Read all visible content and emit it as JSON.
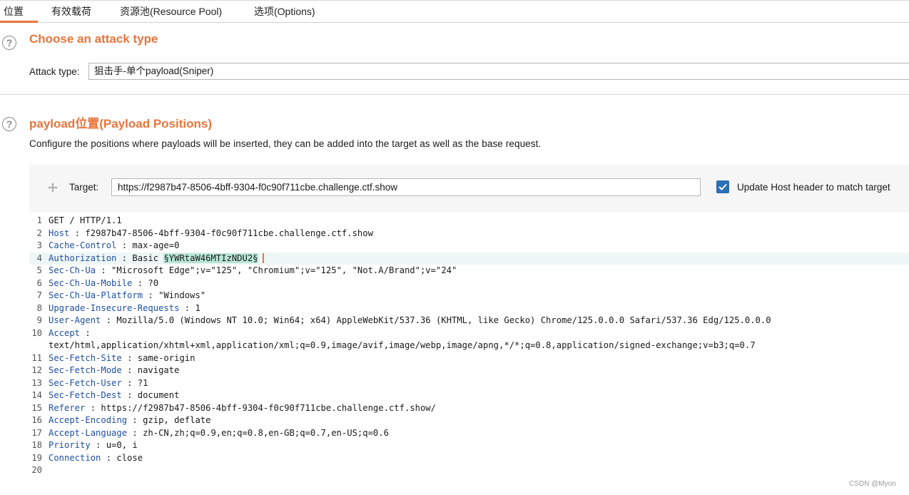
{
  "tabs": [
    "位置",
    "有效载荷",
    "资源池(Resource Pool)",
    "选项(Options)"
  ],
  "attack_section": {
    "title": "Choose an attack type",
    "attack_type_label": "Attack type:",
    "attack_type_value": "狙击手-单个payload(Sniper)"
  },
  "positions_section": {
    "title": "payload位置(Payload Positions)",
    "description": "Configure the positions where payloads will be inserted, they can be added into the target as well as the base request.",
    "target_label": "Target:",
    "target_value": "https://f2987b47-8506-4bff-9304-f0c90f711cbe.challenge.ctf.show",
    "update_host_label": "Update Host header to match target",
    "update_host_checked": true
  },
  "request": {
    "lines": [
      {
        "num": "1",
        "name": "",
        "value": "GET / HTTP/1.1"
      },
      {
        "num": "2",
        "name": "Host",
        "value": " : f2987b47-8506-4bff-9304-f0c90f711cbe.challenge.ctf.show"
      },
      {
        "num": "3",
        "name": "Cache-Control",
        "value": " : max-age=0"
      },
      {
        "num": "4",
        "name": "Authorization",
        "value": " : Basic ",
        "payload": "§YWRtaW46MTIzNDU2§"
      },
      {
        "num": "5",
        "name": "Sec-Ch-Ua",
        "value": " : \"Microsoft Edge\";v=\"125\", \"Chromium\";v=\"125\", \"Not.A/Brand\";v=\"24\""
      },
      {
        "num": "6",
        "name": "Sec-Ch-Ua-Mobile",
        "value": " : ?0"
      },
      {
        "num": "7",
        "name": "Sec-Ch-Ua-Platform",
        "value": " : \"Windows\""
      },
      {
        "num": "8",
        "name": "Upgrade-Insecure-Requests",
        "value": " : 1"
      },
      {
        "num": "9",
        "name": "User-Agent",
        "value": " : Mozilla/5.0 (Windows NT 10.0; Win64; x64) AppleWebKit/537.36 (KHTML, like Gecko) Chrome/125.0.0.0 Safari/537.36 Edg/125.0.0.0"
      },
      {
        "num": "10",
        "name": "Accept",
        "value": " :"
      },
      {
        "num": "",
        "name": "",
        "value": "text/html,application/xhtml+xml,application/xml;q=0.9,image/avif,image/webp,image/apng,*/*;q=0.8,application/signed-exchange;v=b3;q=0.7"
      },
      {
        "num": "11",
        "name": "Sec-Fetch-Site",
        "value": " : same-origin"
      },
      {
        "num": "12",
        "name": "Sec-Fetch-Mode",
        "value": " : navigate"
      },
      {
        "num": "13",
        "name": "Sec-Fetch-User",
        "value": " : ?1"
      },
      {
        "num": "14",
        "name": "Sec-Fetch-Dest",
        "value": " : document"
      },
      {
        "num": "15",
        "name": "Referer",
        "value": " : https://f2987b47-8506-4bff-9304-f0c90f711cbe.challenge.ctf.show/"
      },
      {
        "num": "16",
        "name": "Accept-Encoding",
        "value": " : gzip, deflate"
      },
      {
        "num": "17",
        "name": "Accept-Language",
        "value": " : zh-CN,zh;q=0.9,en;q=0.8,en-GB;q=0.7,en-US;q=0.6"
      },
      {
        "num": "18",
        "name": "Priority",
        "value": " : u=0, i"
      },
      {
        "num": "19",
        "name": "Connection",
        "value": " : close"
      },
      {
        "num": "20",
        "name": "",
        "value": ""
      }
    ]
  },
  "watermark": "CSDN @Myon⁠"
}
